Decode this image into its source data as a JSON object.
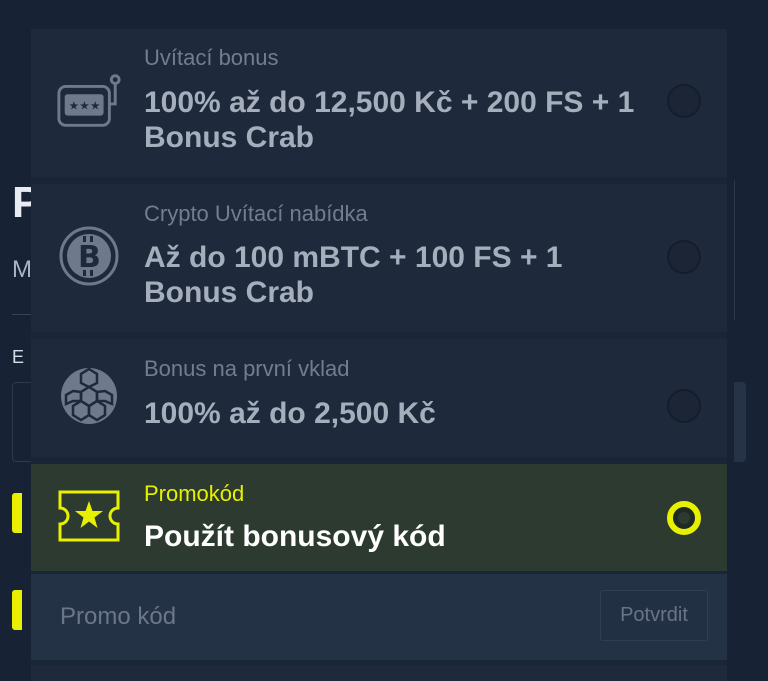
{
  "background": {
    "title_char": "P",
    "sub_char": "M",
    "label_char": "E"
  },
  "options": [
    {
      "subtitle": "Uvítací bonus",
      "title": "100% až do 12,500 Kč + 200 FS + 1 Bonus Crab",
      "icon": "slot-machine-icon",
      "selected": false
    },
    {
      "subtitle": "Crypto Uvítací nabídka",
      "title": "Až do 100 mBTC + 100 FS + 1 Bonus Crab",
      "icon": "bitcoin-icon",
      "selected": false
    },
    {
      "subtitle": "Bonus na první vklad",
      "title": "100% až do 2,500 Kč",
      "icon": "soccer-ball-icon",
      "selected": false
    },
    {
      "subtitle": "Promokód",
      "title": "Použít bonusový kód",
      "icon": "ticket-star-icon",
      "selected": true
    }
  ],
  "promo": {
    "placeholder": "Promo kód",
    "confirm_label": "Potvrdit"
  },
  "colors": {
    "accent": "#e6f000",
    "panel": "#1e2a3c",
    "background": "#172234"
  }
}
